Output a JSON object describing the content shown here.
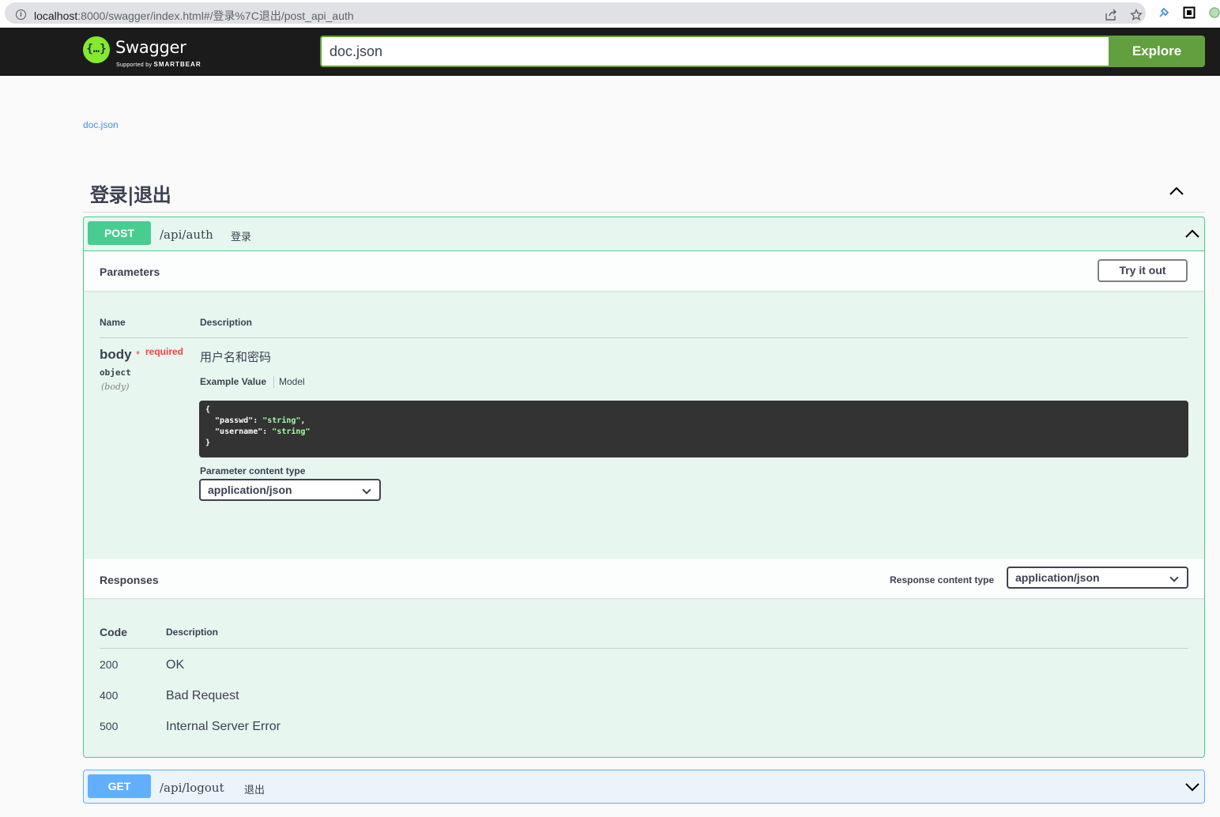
{
  "browser": {
    "url_host": "localhost",
    "url_rest": ":8000/swagger/index.html#/登录%7C退出/post_api_auth",
    "info_icon": "i"
  },
  "topbar": {
    "logo_glyph": "{…}",
    "logo_text": "Swagger",
    "logo_sub_prefix": "Supported by",
    "logo_sub_brand": "SMARTBEAR",
    "url_value": "doc.json",
    "explore_label": "Explore"
  },
  "info": {
    "doc_link": "doc.json"
  },
  "tag": {
    "title": "登录|退出"
  },
  "post_op": {
    "method": "POST",
    "method_color": "#49cc90",
    "path": "/api/auth",
    "summary": "登录",
    "parameters_label": "Parameters",
    "try_label": "Try it out",
    "col_name": "Name",
    "col_description": "Description",
    "param": {
      "name": "body",
      "star": "*",
      "required": "required",
      "type": "object",
      "in": "(body)",
      "description": "用户名和密码",
      "example_tab": "Example Value",
      "model_tab": "Model",
      "code": {
        "open": "{",
        "line1_key": "  \"passwd\": ",
        "line1_val": "\"string\"",
        "line1_end": ",",
        "line2_key": "  \"username\": ",
        "line2_val": "\"string\"",
        "close": "}"
      },
      "content_type_label": "Parameter content type",
      "content_type_value": "application/json"
    },
    "responses_label": "Responses",
    "response_content_type_label": "Response content type",
    "response_content_type_value": "application/json",
    "col_code": "Code",
    "col_resp_description": "Description",
    "responses": [
      {
        "code": "200",
        "description": "OK"
      },
      {
        "code": "400",
        "description": "Bad Request"
      },
      {
        "code": "500",
        "description": "Internal Server Error"
      }
    ]
  },
  "get_op": {
    "method": "GET",
    "method_color": "#61affe",
    "path": "/api/logout",
    "summary": "退出"
  }
}
